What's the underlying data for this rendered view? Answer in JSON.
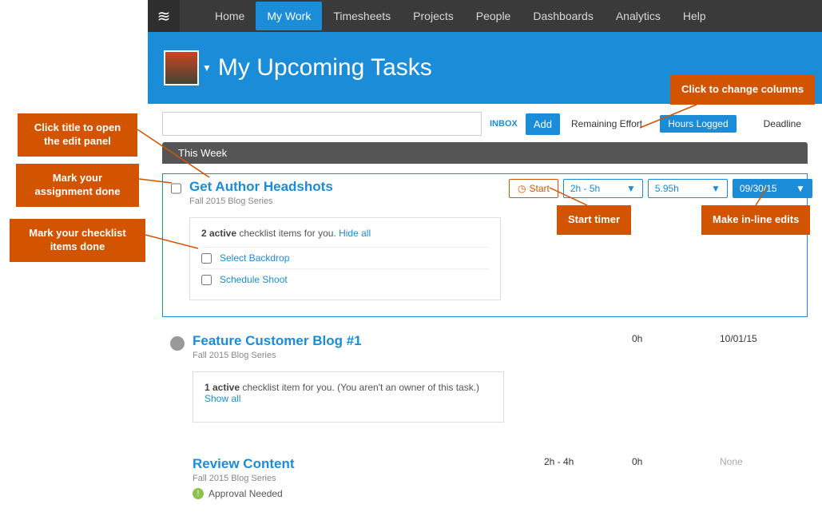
{
  "nav": {
    "items": [
      "Home",
      "My Work",
      "Timesheets",
      "Projects",
      "People",
      "Dashboards",
      "Analytics",
      "Help"
    ],
    "active": 1
  },
  "page_title": "My Upcoming Tasks",
  "toolbar": {
    "inbox": "INBOX",
    "add": "Add",
    "col_remaining": "Remaining Effort",
    "col_hours": "Hours Logged",
    "col_deadline": "Deadline"
  },
  "section": "This Week",
  "tasks": [
    {
      "title": "Get Author Headshots",
      "subtitle": "Fall 2015 Blog Series",
      "start": "Start",
      "effort": "2h - 5h",
      "hours": "5.95h",
      "deadline": "09/30/15",
      "checklist_summary_count": "2 active",
      "checklist_summary_rest": " checklist items for you. ",
      "checklist_toggle": "Hide all",
      "items": [
        "Select Backdrop",
        "Schedule Shoot"
      ]
    },
    {
      "title": "Feature Customer Blog #1",
      "subtitle": "Fall 2015 Blog Series",
      "effort": "",
      "hours": "0h",
      "deadline": "10/01/15",
      "checklist_summary_count": "1 active",
      "checklist_summary_rest": " checklist item for you. (You aren't an owner of this task.)",
      "checklist_toggle": "Show all"
    },
    {
      "title": "Review Content",
      "subtitle": "Fall 2015 Blog Series",
      "effort": "2h - 4h",
      "hours": "0h",
      "deadline": "None",
      "approval": "Approval Needed"
    }
  ],
  "callouts": {
    "c1": "Click title to open the edit panel",
    "c2": "Mark your assignment done",
    "c3": "Mark your checklist items done",
    "c4": "Click to change columns",
    "c5": "Start timer",
    "c6": "Make in-line edits"
  }
}
